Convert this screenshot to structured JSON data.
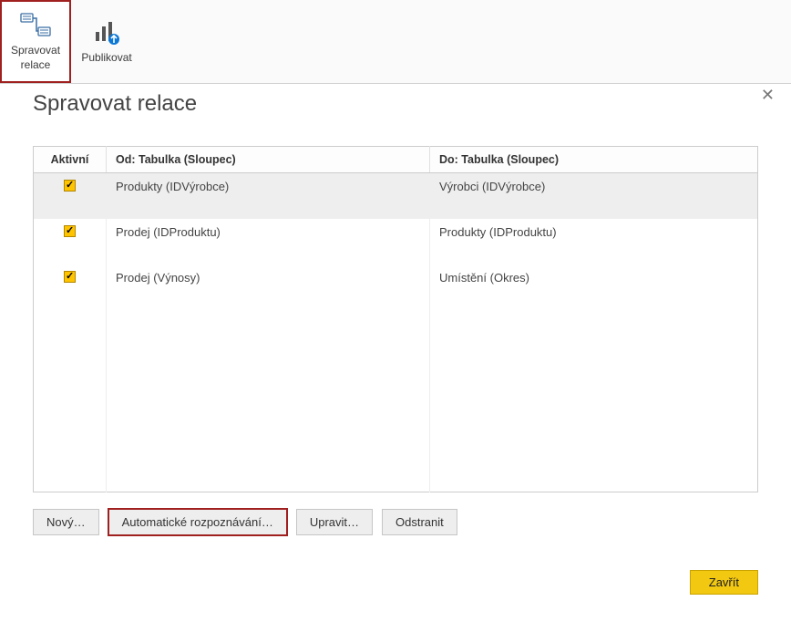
{
  "ribbon": {
    "manage_relations_label": "Spravovat\nrelace",
    "publish_label": "Publikovat"
  },
  "dialog": {
    "title": "Spravovat relace",
    "headers": {
      "active": "Aktivní",
      "from": "Od: Tabulka (Sloupec)",
      "to": "Do: Tabulka (Sloupec)"
    },
    "rows": [
      {
        "active": true,
        "from": "Produkty (IDVýrobce)",
        "to": "Výrobci (IDVýrobce)",
        "selected": true
      },
      {
        "active": true,
        "from": "Prodej (IDProduktu)",
        "to": "Produkty (IDProduktu)",
        "selected": false
      },
      {
        "active": true,
        "from": "Prodej (Výnosy)",
        "to": "Umístění (Okres)",
        "selected": false
      }
    ],
    "buttons": {
      "new": "Nový…",
      "autodetect": "Automatické rozpoznávání…",
      "edit": "Upravit…",
      "delete": "Odstranit"
    },
    "close_button": "Zavřít"
  }
}
